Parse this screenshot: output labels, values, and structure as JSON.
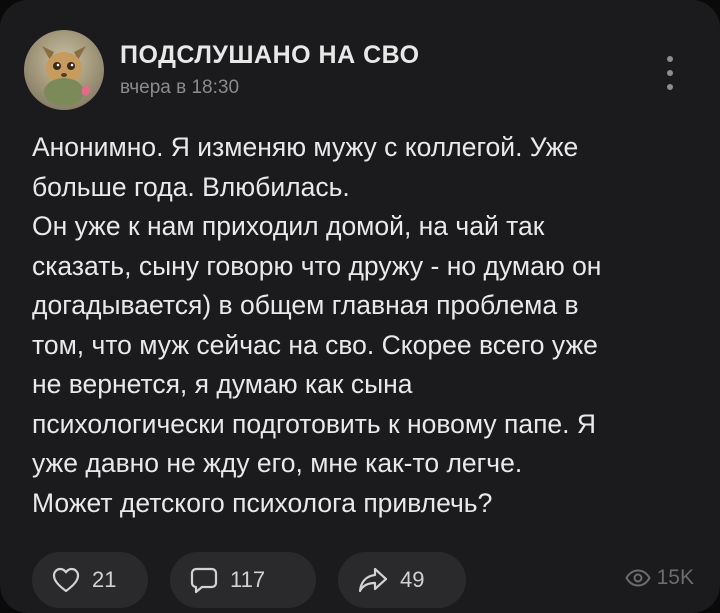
{
  "header": {
    "title": "ПОДСЛУШАНО НА СВО",
    "time": "вчера в 18:30"
  },
  "post": {
    "lines": [
      "Анонимно. Я изменяю мужу с коллегой. Уже",
      "больше года. Влюбилась.",
      "Он уже к нам приходил домой, на чай так",
      "сказать, сыну говорю что дружу - но думаю он",
      "догадывается) в общем главная проблема в",
      "том, что муж сейчас на сво. Скорее всего уже",
      "не вернется, я думаю как сына",
      "психологически подготовить к новому папе. Я",
      "уже давно не жду его, мне как-то легче.",
      "Может детского психолога привлечь?"
    ]
  },
  "actions": {
    "likes": "21",
    "comments": "117",
    "shares": "49",
    "views": "15K"
  },
  "icons": {
    "like": "heart-icon",
    "comment": "comment-icon",
    "share": "share-icon",
    "views": "eye-icon",
    "more": "more-vertical-icon"
  }
}
